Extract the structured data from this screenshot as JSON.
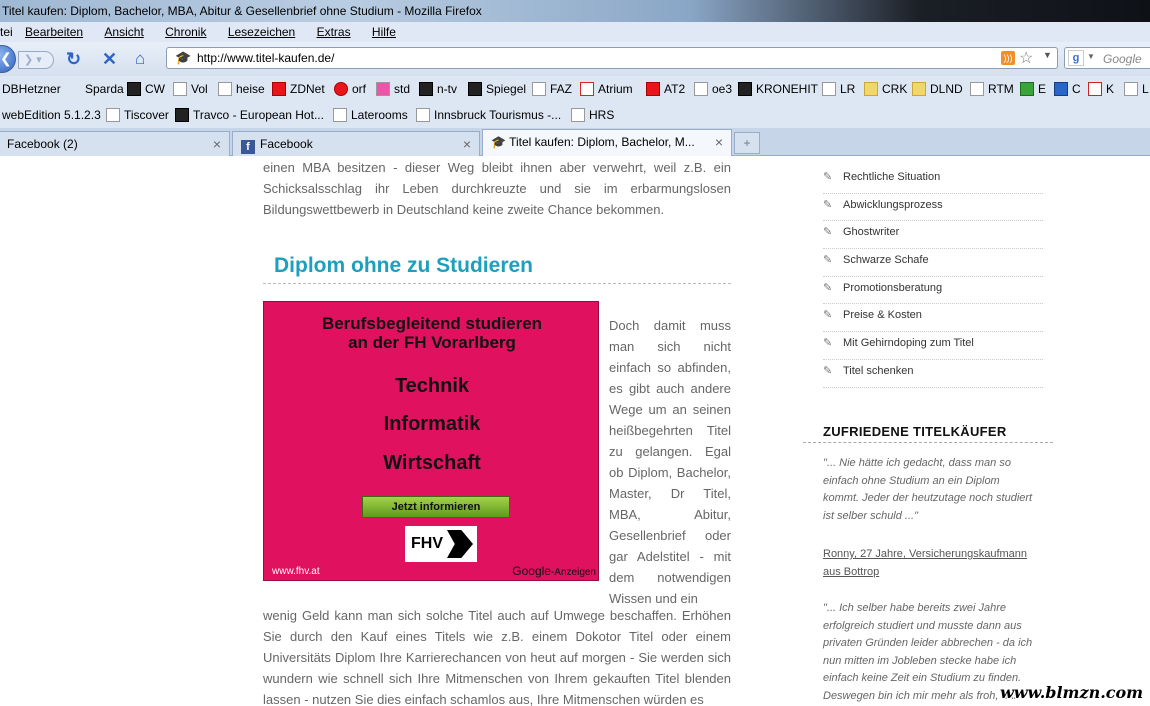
{
  "window": {
    "title": "Titel kaufen: Diplom, Bachelor, MBA, Abitur & Gesellenbrief ohne Studium - Mozilla Firefox"
  },
  "menu": [
    "tei",
    "Bearbeiten",
    "Ansicht",
    "Chronik",
    "Lesezeichen",
    "Extras",
    "Hilfe"
  ],
  "navbar": {
    "url": "http://www.titel-kaufen.de/",
    "search_placeholder": "Google"
  },
  "bookmarks_row1": [
    "DBHetzner",
    "Sparda",
    "CW",
    "Vol",
    "heise",
    "ZDNet",
    "orf",
    "std",
    "n-tv",
    "Spiegel",
    "FAZ",
    "Atrium",
    "AT2",
    "oe3",
    "KRONEHIT",
    "LR",
    "CRK",
    "DLND",
    "RTM",
    "E",
    "C",
    "K",
    "L"
  ],
  "bookmarks_row2": [
    "webEdition 5.1.2.3",
    "Tiscover",
    "Travco - European Hot...",
    "Laterooms",
    "Innsbruck Tourismus -...",
    "HRS"
  ],
  "tabs": [
    "Facebook (2)",
    "Facebook",
    "Titel kaufen: Diplom, Bachelor, M..."
  ],
  "article": {
    "intro": "einen MBA besitzen - dieser Weg bleibt ihnen aber verwehrt, weil z.B. ein Schicksalsschlag ihr Leben durchkreuzte und sie im erbarmungslosen Bildungswettbewerb in Deutschland keine zweite Chance bekommen.",
    "heading": "Diplom ohne zu Studieren",
    "wrap_text": "Doch damit muss man sich nicht einfach so abfinden, es gibt auch andere Wege um an seinen heißbegehrten Titel zu gelangen. Egal ob Diplom, Bachelor, Master, Dr Titel, MBA, Abitur, Gesellenbrief oder gar Adelstitel - mit dem notwendigen Wissen und ein",
    "after_text": "wenig Geld kann man sich solche Titel auch auf Umwege beschaffen. Erhöhen Sie durch den Kauf eines Titels wie z.B. einem Dokotor Titel oder einem Universitäts Diplom Ihre Karrierechancen von heut auf morgen - Sie werden sich wundern wie schnell sich Ihre Mitmenschen von Ihrem gekauften Titel blenden lassen - nutzen Sie dies einfach schamlos aus, Ihre Mitmenschen würden es"
  },
  "ad": {
    "headline_line1": "Berufsbegleitend studieren",
    "headline_line2": "an der FH Vorarlberg",
    "items": [
      "Technik",
      "Informatik",
      "Wirtschaft"
    ],
    "cta": "Jetzt informieren",
    "logo": "FHV",
    "url": "www.fhv.at",
    "google": "Google",
    "google_suffix": "-Anzeigen"
  },
  "sidebar": {
    "links": [
      "Rechtliche Situation",
      "Abwicklungsprozess",
      "Ghostwriter",
      "Schwarze Schafe",
      "Promotionsberatung",
      "Preise & Kosten",
      "Mit Gehirndoping zum Titel",
      "Titel schenken"
    ],
    "heading": "ZUFRIEDENE TITELKÄUFER",
    "testimonial1": "\"... Nie hätte ich gedacht, dass man so einfach ohne Studium an ein Diplom kommt. Jeder der heutzutage noch studiert ist selber schuld ...\"",
    "testimonial1_author": "Ronny, 27 Jahre, Versicherungskaufmann aus Bottrop",
    "testimonial2": "\"... Ich selber habe bereits zwei Jahre erfolgreich studiert und musste dann aus privaten Gründen leider abbrechen - da ich nun mitten im Jobleben stecke habe ich einfach keine Zeit ein Studium zu finden. Deswegen bin ich mir mehr als froh, das"
  },
  "watermark": "www.blmzn.com",
  "colors": {
    "heading": "#1e9fbd",
    "ad_bg": "#e0115f",
    "body_text": "#666666"
  }
}
